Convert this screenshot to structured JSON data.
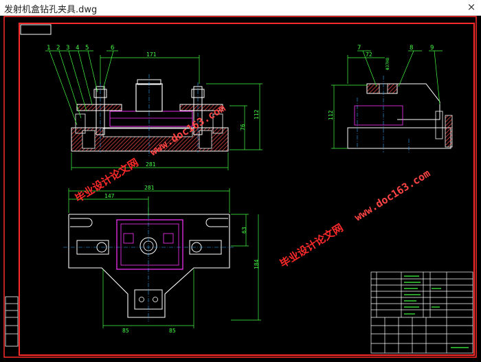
{
  "window": {
    "title": "发射机盒钻孔夹具.dwg",
    "close_glyph": "×"
  },
  "colors": {
    "background": "#000000",
    "frame": "#ff2a2a",
    "part": "#f0f0f0",
    "dimension": "#44ff44",
    "hatch": "#ff5555",
    "leader": "#44ff44",
    "center": "#33aaff",
    "internal": "#ff33ff",
    "watermark": "#ff2a2a",
    "watermark_link": "#ff4444"
  },
  "drawing": {
    "balloons": [
      "1",
      "2",
      "3",
      "4",
      "5",
      "6",
      "7",
      "8",
      "9"
    ],
    "front_dims": {
      "top_width": "171",
      "bottom_width": "281",
      "height_inner": "76",
      "height_total": "112"
    },
    "side_dims": {
      "top_width": "72",
      "hole": "Φ37H8",
      "height": "112"
    },
    "plan_dims": {
      "overall_width": "281",
      "left_offset": "147",
      "depth_upper": "63",
      "depth_total": "184",
      "half_left": "85",
      "half_right": "85"
    }
  },
  "watermarks": [
    {
      "line1": "毕业设计论文网",
      "line2": "www.doc163.com"
    },
    {
      "line1": "毕业设计论文网",
      "line2": "www.doc163.com"
    }
  ]
}
